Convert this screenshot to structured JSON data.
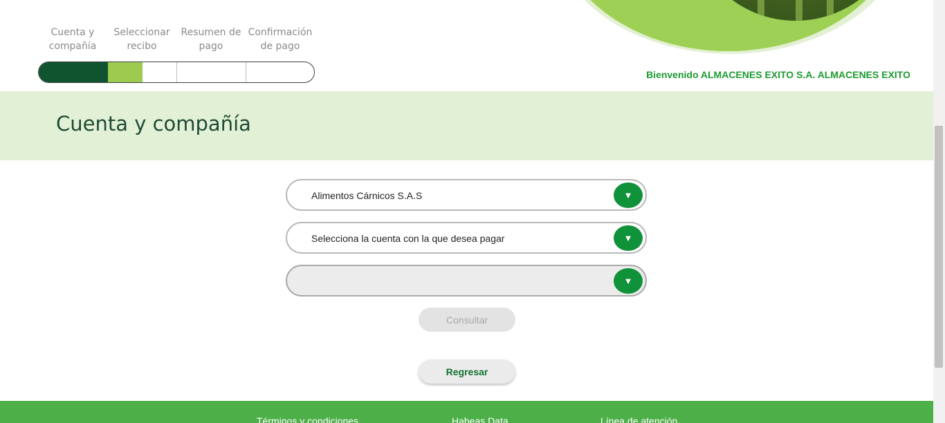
{
  "steps": {
    "items": [
      {
        "label": "Cuenta y compañía"
      },
      {
        "label": "Seleccionar recibo"
      },
      {
        "label": "Resumen de pago"
      },
      {
        "label": "Confirmación de pago"
      }
    ],
    "progress_fraction": 0.375
  },
  "header": {
    "welcome": "Bienvenido ALMACENES EXITO S.A. ALMACENES EXITO"
  },
  "page": {
    "title": "Cuenta y compañía"
  },
  "form": {
    "company_select": {
      "value": "Alimentos Cárnicos S.A.S"
    },
    "account_select": {
      "value": "Selecciona la cuenta con la que desea pagar"
    },
    "third_select": {
      "value": ""
    },
    "dropdown_icon": "triangle-down-icon",
    "consultar_label": "Consultar",
    "regresar_label": "Regresar"
  },
  "footer": {
    "links": [
      "Términos y condiciones",
      "Habeas Data",
      "Línea de atención"
    ]
  },
  "colors": {
    "brand_dark": "#10532f",
    "brand_light": "#9ccb50",
    "accent_green": "#10923a",
    "band_bg": "#e2f1d6",
    "footer_bg": "#4caf48",
    "welcome_text": "#1d9a2f"
  }
}
